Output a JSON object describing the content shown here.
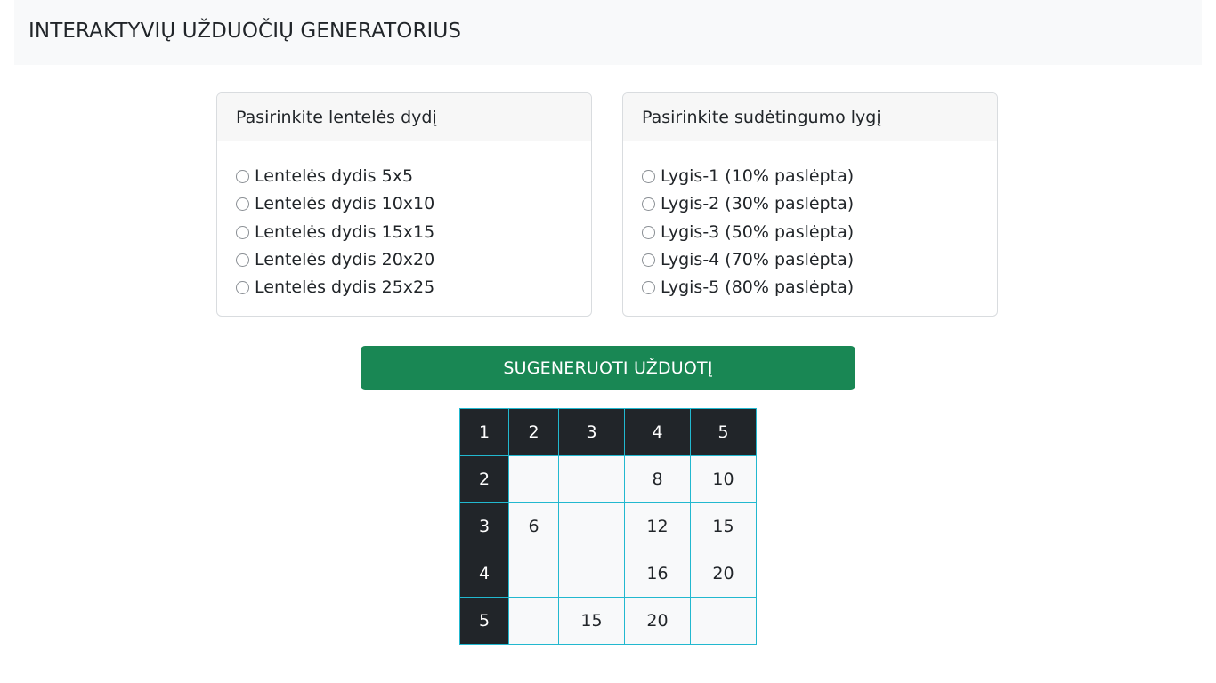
{
  "header": {
    "title": "INTERAKTYVIŲ UŽDUOČIŲ GENERATORIUS"
  },
  "size_card": {
    "title": "Pasirinkite lentelės dydį",
    "options": [
      "Lentelės dydis 5x5",
      "Lentelės dydis 10x10",
      "Lentelės dydis 15x15",
      "Lentelės dydis 20x20",
      "Lentelės dydis 25x25"
    ]
  },
  "level_card": {
    "title": "Pasirinkite sudėtingumo lygį",
    "options": [
      "Lygis-1 (10% paslėpta)",
      "Lygis-2 (30% paslėpta)",
      "Lygis-3 (50% paslėpta)",
      "Lygis-4 (70% paslėpta)",
      "Lygis-5 (80% paslėpta)"
    ]
  },
  "generate_button": {
    "label": "SUGENERUOTI UŽDUOTĮ"
  },
  "table": {
    "header_row": [
      "1",
      "2",
      "3",
      "4",
      "5"
    ],
    "rows": [
      {
        "head": "2",
        "cells": [
          "",
          "",
          "8",
          "10"
        ]
      },
      {
        "head": "3",
        "cells": [
          "6",
          "",
          "12",
          "15"
        ]
      },
      {
        "head": "4",
        "cells": [
          "",
          "",
          "16",
          "20"
        ]
      },
      {
        "head": "5",
        "cells": [
          "",
          "15",
          "20",
          ""
        ]
      }
    ]
  },
  "colors": {
    "header_bg": "#f8f9fa",
    "button_bg": "#198754",
    "table_header_bg": "#212529",
    "table_border": "#22b8cf"
  }
}
